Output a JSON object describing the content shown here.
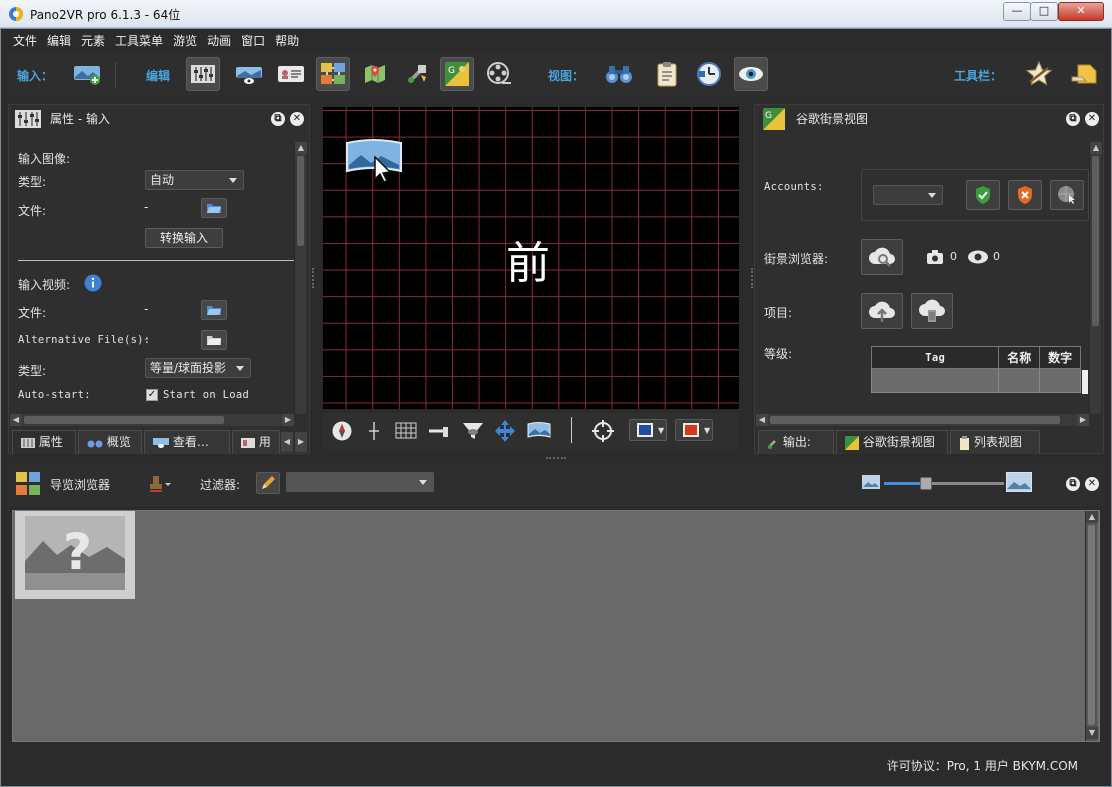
{
  "window": {
    "title": "Pano2VR pro 6.1.3 - 64位",
    "min": "—",
    "max": "□",
    "close": "✕"
  },
  "menu": [
    "文件",
    "编辑",
    "元素",
    "工具菜单",
    "游览",
    "动画",
    "窗口",
    "帮助"
  ],
  "toolbar": {
    "input_label": "输入：",
    "edit_label": "编辑",
    "view_label": "视图：",
    "tools_label": "工具栏："
  },
  "props": {
    "title": "属性 - 输入",
    "input_image": "输入图像:",
    "type_label": "类型:",
    "type_value": "自动",
    "file_label": "文件:",
    "file_value": "-",
    "convert_button": "转换输入",
    "input_video": "输入视频:",
    "vfile_label": "文件:",
    "vfile_value": "-",
    "alt_label": "Alternative File(s):",
    "alt_value": "-",
    "vtype_label": "类型:",
    "vtype_value": "等量/球面投影",
    "autostart_label": "Auto-start:",
    "autostart_check": "Start on Load",
    "check_mark": "✓",
    "tabs": [
      "属性",
      "概览",
      "查看…",
      "用"
    ]
  },
  "viewer": {
    "face": "前"
  },
  "gsv": {
    "title": "谷歌街景视图",
    "accounts": "Accounts:",
    "browser_label": "街景浏览器:",
    "photo_count": "0",
    "view_count": "0",
    "project_label": "项目:",
    "level_label": "等级:",
    "columns": [
      "Tag",
      "名称",
      "数字"
    ],
    "tabs": [
      "输出:",
      "谷歌街景视图",
      "列表视图"
    ]
  },
  "tour": {
    "title": "导览浏览器",
    "filter": "过滤器:"
  },
  "status": {
    "license": "许可协议：Pro, 1 用户 BKYM.COM"
  },
  "colors": {
    "accent": "#4aa3df",
    "grid": "#8b2b35",
    "panel": "#2f2f2f"
  }
}
